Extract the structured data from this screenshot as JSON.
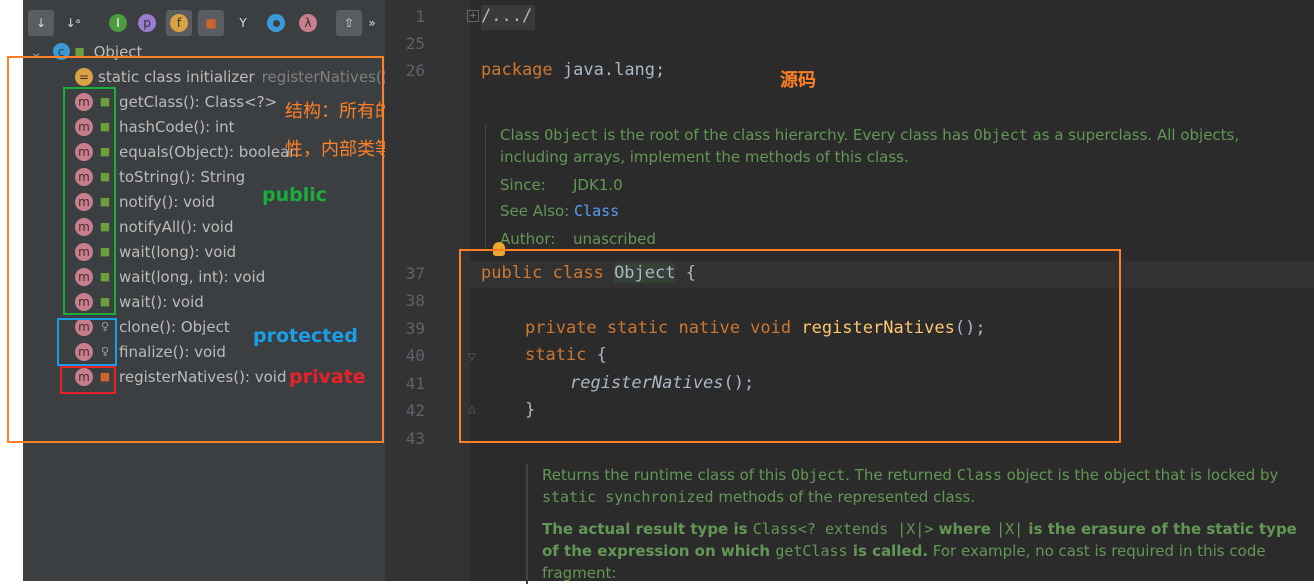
{
  "toolbar": {
    "buttons": [
      "sort-by-visibility",
      "sort-alphabetically",
      "show-inherited",
      "show-properties",
      "show-fields",
      "show-non-public",
      "show-anonymous",
      "show-lambdas",
      "autoscroll"
    ],
    "more": "»"
  },
  "tree": {
    "root": "Object",
    "initializer": {
      "label": "static class initializer",
      "detail": "registerNatives();"
    },
    "methods": [
      {
        "label": "getClass(): Class<?>",
        "visibility": "public"
      },
      {
        "label": "hashCode(): int",
        "visibility": "public"
      },
      {
        "label": "equals(Object): boolean",
        "visibility": "public"
      },
      {
        "label": "toString(): String",
        "visibility": "public"
      },
      {
        "label": "notify(): void",
        "visibility": "public"
      },
      {
        "label": "notifyAll(): void",
        "visibility": "public"
      },
      {
        "label": "wait(long): void",
        "visibility": "public"
      },
      {
        "label": "wait(long, int): void",
        "visibility": "public"
      },
      {
        "label": "wait(): void",
        "visibility": "public"
      },
      {
        "label": "clone(): Object",
        "visibility": "protected"
      },
      {
        "label": "finalize(): void",
        "visibility": "protected"
      },
      {
        "label": "registerNatives(): void",
        "visibility": "private"
      }
    ]
  },
  "annotations": {
    "structure_line1": "结构：所有的方法，属",
    "structure_line2": "性，内部类等声明",
    "public": "public",
    "protected": "protected",
    "private": "private",
    "source": "源码"
  },
  "editor": {
    "line_numbers": [
      "1",
      "25",
      "26",
      "37",
      "38",
      "39",
      "40",
      "41",
      "42",
      "43"
    ],
    "fold": "/.../",
    "package_kw": "package",
    "package_name": "java.lang;",
    "doc1": {
      "p1a": "Class ",
      "p1b": "Object",
      "p1c": " is the root of the class hierarchy. Every class has ",
      "p1d": "Object",
      "p1e": " as a superclass. All objects, including arrays, implement the methods of this class.",
      "since_label": "Since:",
      "since": "JDK1.0",
      "see_label": "See Also:",
      "see": "Class",
      "author_label": "Author:",
      "author": "unascribed"
    },
    "l37": {
      "kw": "public class ",
      "name": "Object",
      "rest": " {"
    },
    "l39": {
      "kw": "private static native void ",
      "fn": "registerNatives",
      "rest": "();"
    },
    "l40": {
      "kw": "static",
      "rest": " {"
    },
    "l41": {
      "fn": "registerNatives",
      "rest": "();"
    },
    "l42": "}",
    "doc2": {
      "a": "Returns the runtime class of this ",
      "b": "Object",
      "c": ". The returned ",
      "d": "Class",
      "e": " object is the object that is locked by ",
      "f": "static synchronized",
      "g": " methods of the represented class.",
      "h": "The actual result type is ",
      "i": "Class<? extends |X|>",
      "j": " where ",
      "k": "|X|",
      "l": " is the erasure of the static type of the expression on which ",
      "m": "getClass",
      "n": " is called.",
      "o": " For example, no cast is required in this code fragment:"
    }
  },
  "colors": {
    "public": "#1aad3a",
    "protected": "#1a9ee8",
    "private": "#e8202a",
    "highlight": "#ff7f27"
  }
}
